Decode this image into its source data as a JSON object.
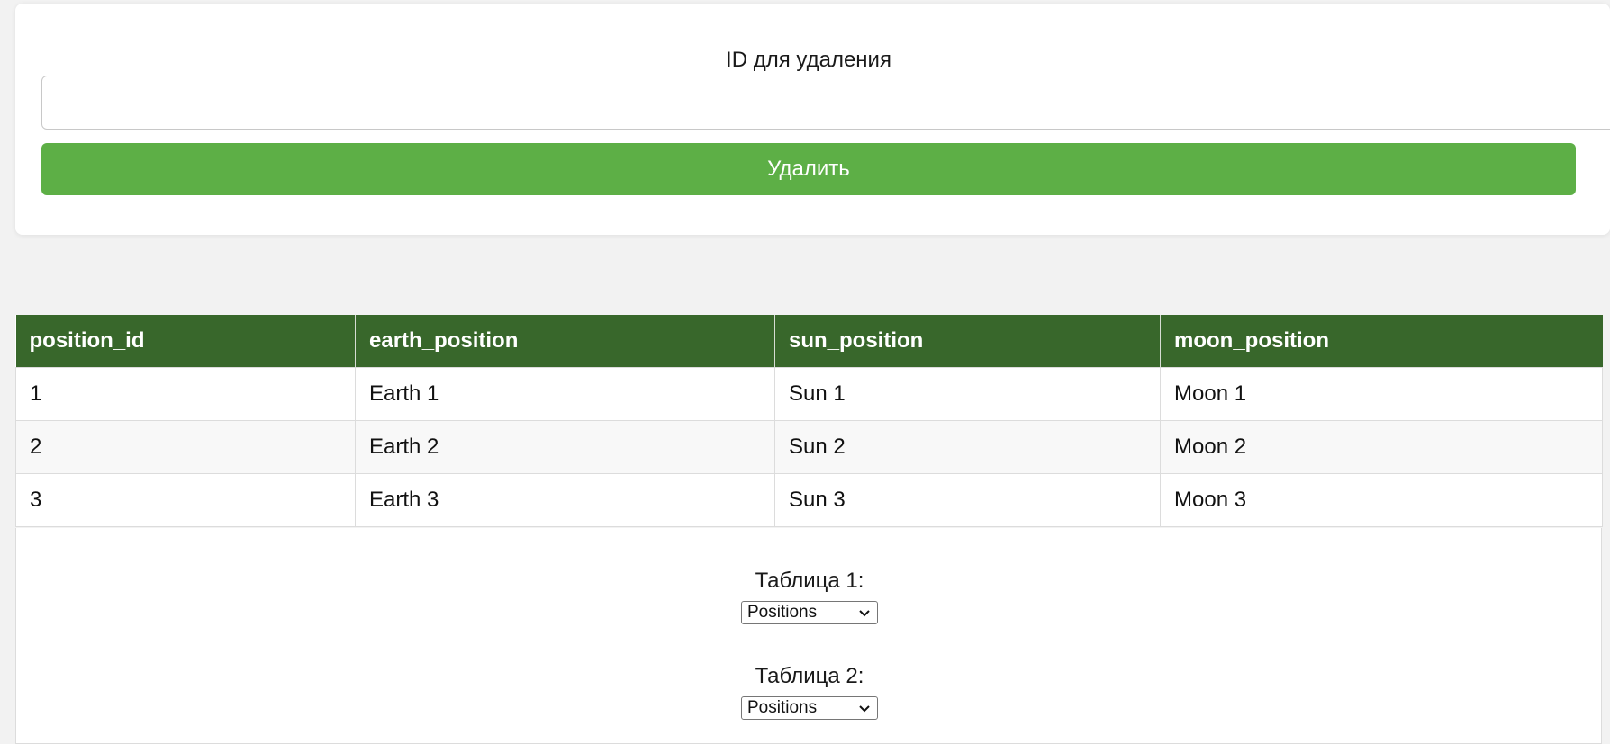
{
  "delete_form": {
    "label": "ID для удаления",
    "input_value": "",
    "input_placeholder": "",
    "button_label": "Удалить"
  },
  "table": {
    "headers": [
      "position_id",
      "earth_position",
      "sun_position",
      "moon_position"
    ],
    "rows": [
      [
        "1",
        "Earth 1",
        "Sun 1",
        "Moon 1"
      ],
      [
        "2",
        "Earth 2",
        "Sun 2",
        "Moon 2"
      ],
      [
        "3",
        "Earth 3",
        "Sun 3",
        "Moon 3"
      ]
    ]
  },
  "join_form": {
    "table1_label": "Таблица 1:",
    "table1_selected": "Positions",
    "table2_label": "Таблица 2:",
    "table2_selected": "Positions"
  },
  "colors": {
    "button_green": "#5daf46",
    "header_green": "#38672b",
    "background": "#f2f2f2"
  }
}
